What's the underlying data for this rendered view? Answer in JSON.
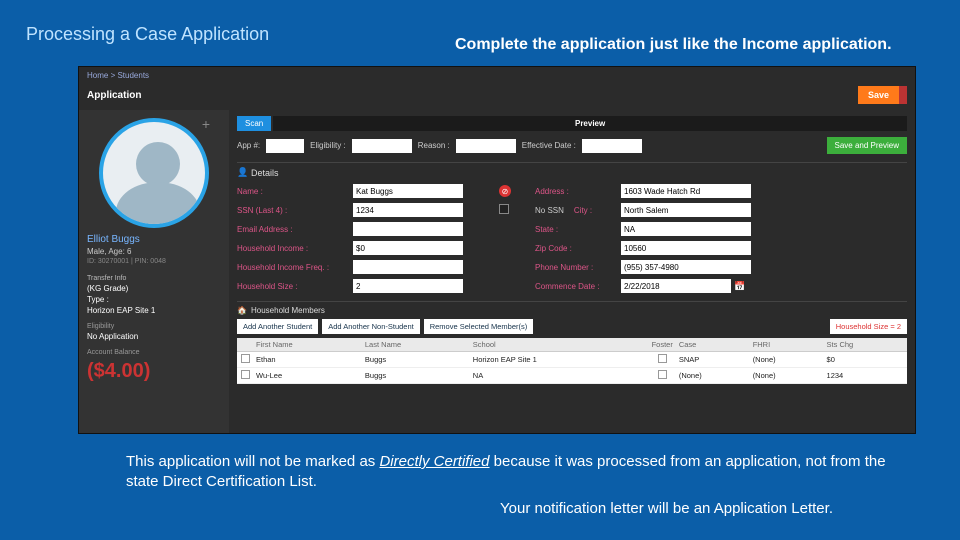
{
  "slide": {
    "title": "Processing a Case Application",
    "subtitle": "Complete the application just like the Income application.",
    "footnote_a": "This application will not be marked as ",
    "footnote_em": "Directly Certified",
    "footnote_b": " because it was processed from an application, not from the state Direct Certification List.",
    "footnote2": "Your notification letter will be an Application Letter."
  },
  "breadcrumbs": "Home > Students",
  "page_title": "Application",
  "save_btn": "Save",
  "tabs": {
    "scan": "Scan",
    "preview": "Preview"
  },
  "toprow": {
    "app_lbl": "App #:",
    "app_val": "",
    "elig_lbl": "Eligibility :",
    "elig_val": "",
    "reason_lbl": "Reason :",
    "reason_val": "",
    "eff_lbl": "Effective Date :",
    "eff_val": "",
    "save_preview": "Save and Preview"
  },
  "profile": {
    "name": "Elliot Buggs",
    "meta": "Male, Age: 6",
    "id": "ID: 30270001 | PIN: 0048",
    "transfer": "Transfer Info",
    "grade": "(KG Grade)",
    "type": "Type :",
    "site": "Horizon EAP Site 1",
    "elig_lbl": "Eligibility",
    "elig_val": "No Application",
    "bal_lbl": "Account Balance",
    "balance": "($4.00)"
  },
  "details": {
    "header": "Details",
    "name_lbl": "Name :",
    "name_val": "Kat Buggs",
    "addr_lbl": "Address :",
    "addr_val": "1603 Wade Hatch Rd",
    "ssn_lbl": "SSN (Last 4) :",
    "ssn_val": "1234",
    "nossn": "No SSN",
    "city_lbl": "City :",
    "city_val": "North Salem",
    "email_lbl": "Email Address :",
    "email_val": "",
    "state_lbl": "State :",
    "state_val": "NA",
    "hhi_lbl": "Household Income :",
    "hhi_val": "$0",
    "zip_lbl": "Zip Code :",
    "zip_val": "10560",
    "freq_lbl": "Household Income Freq. :",
    "freq_val": "",
    "phone_lbl": "Phone Number :",
    "phone_val": "(955) 357-4980",
    "size_lbl": "Household Size :",
    "size_val": "2",
    "comm_lbl": "Commence Date :",
    "comm_val": "2/22/2018"
  },
  "members": {
    "header": "Household Members",
    "add_student": "Add Another Student",
    "add_non": "Add Another Non-Student",
    "remove": "Remove Selected Member(s)",
    "hhsize": "Household Size = 2",
    "cols": [
      "",
      "First Name",
      "Last Name",
      "School",
      "Foster",
      "Case",
      "FHRI",
      "Sts Chg"
    ],
    "rows": [
      {
        "first": "Ethan",
        "last": "Buggs",
        "school": "Horizon EAP Site 1",
        "foster": false,
        "case": "SNAP",
        "fhri": "(None)",
        "sts": "$0"
      },
      {
        "first": "Wu-Lee",
        "last": "Buggs",
        "school": "NA",
        "foster": false,
        "case": "(None)",
        "fhri": "(None)",
        "sts": "1234"
      }
    ]
  }
}
